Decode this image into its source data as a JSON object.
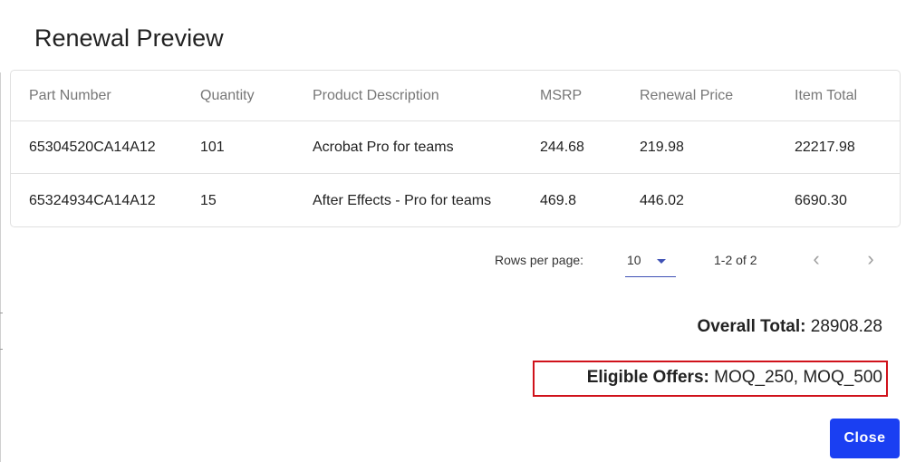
{
  "dialog": {
    "title": "Renewal Preview"
  },
  "table": {
    "columns": [
      "Part Number",
      "Quantity",
      "Product Description",
      "MSRP",
      "Renewal Price",
      "Item Total"
    ],
    "rows": [
      [
        "65304520CA14A12",
        "101",
        "Acrobat Pro for teams",
        "244.68",
        "219.98",
        "22217.98"
      ],
      [
        "65324934CA14A12",
        "15",
        "After Effects - Pro for teams",
        "469.8",
        "446.02",
        "6690.30"
      ]
    ]
  },
  "pagination": {
    "rows_per_page_label": "Rows per page:",
    "rows_per_page_value": "10",
    "range_text": "1-2 of 2",
    "prev_glyph": "‹",
    "next_glyph": "›"
  },
  "summary": {
    "overall_total_label": "Overall Total:",
    "overall_total_value": "28908.28",
    "eligible_offers_label": "Eligible Offers:",
    "eligible_offers_value": "MOQ_250, MOQ_500"
  },
  "actions": {
    "close_label": "Close"
  },
  "colors": {
    "primary": "#1a3ff2",
    "select_accent": "#3f51b5",
    "highlight_border": "#d0121b"
  }
}
